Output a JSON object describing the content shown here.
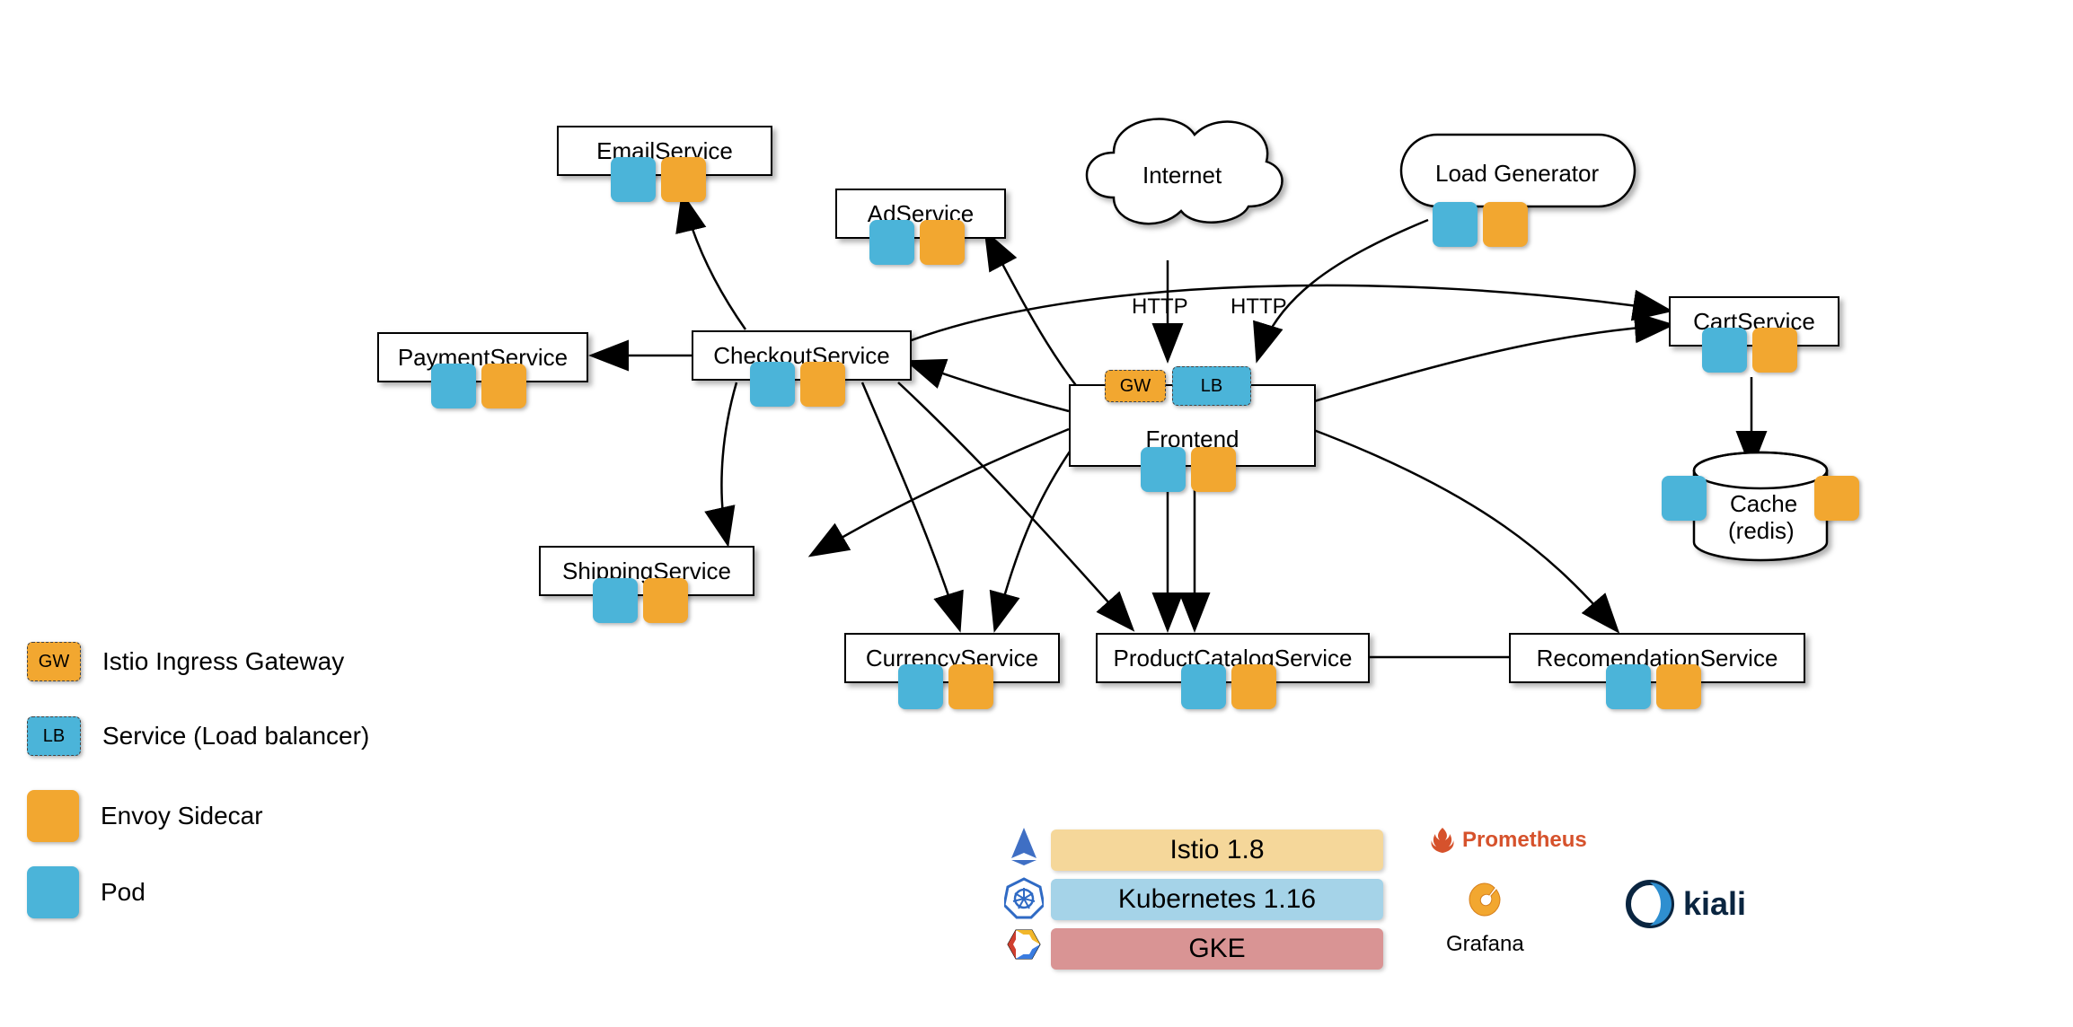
{
  "nodes": {
    "email": "EmailService",
    "ad": "AdService",
    "payment": "PaymentService",
    "checkout": "CheckoutService",
    "shipping": "ShippingService",
    "currency": "CurrencyService",
    "product": "ProductCatalogService",
    "recommendation": "RecomendationService",
    "cart": "CartService",
    "loadgen": "Load Generator",
    "internet": "Internet",
    "frontend": "Frontend",
    "cache_line1": "Cache",
    "cache_line2": "(redis)"
  },
  "tags": {
    "gw": "GW",
    "lb": "LB"
  },
  "edge_labels": {
    "http1": "HTTP",
    "http2": "HTTP"
  },
  "legend": {
    "gw": "Istio Ingress Gateway",
    "lb": "Service (Load balancer)",
    "envoy": "Envoy Sidecar",
    "pod": "Pod"
  },
  "stack": {
    "istio": "Istio 1.8",
    "k8s": "Kubernetes 1.16",
    "gke": "GKE"
  },
  "logos": {
    "prometheus": "Prometheus",
    "grafana": "Grafana",
    "kiali": "kiali"
  }
}
